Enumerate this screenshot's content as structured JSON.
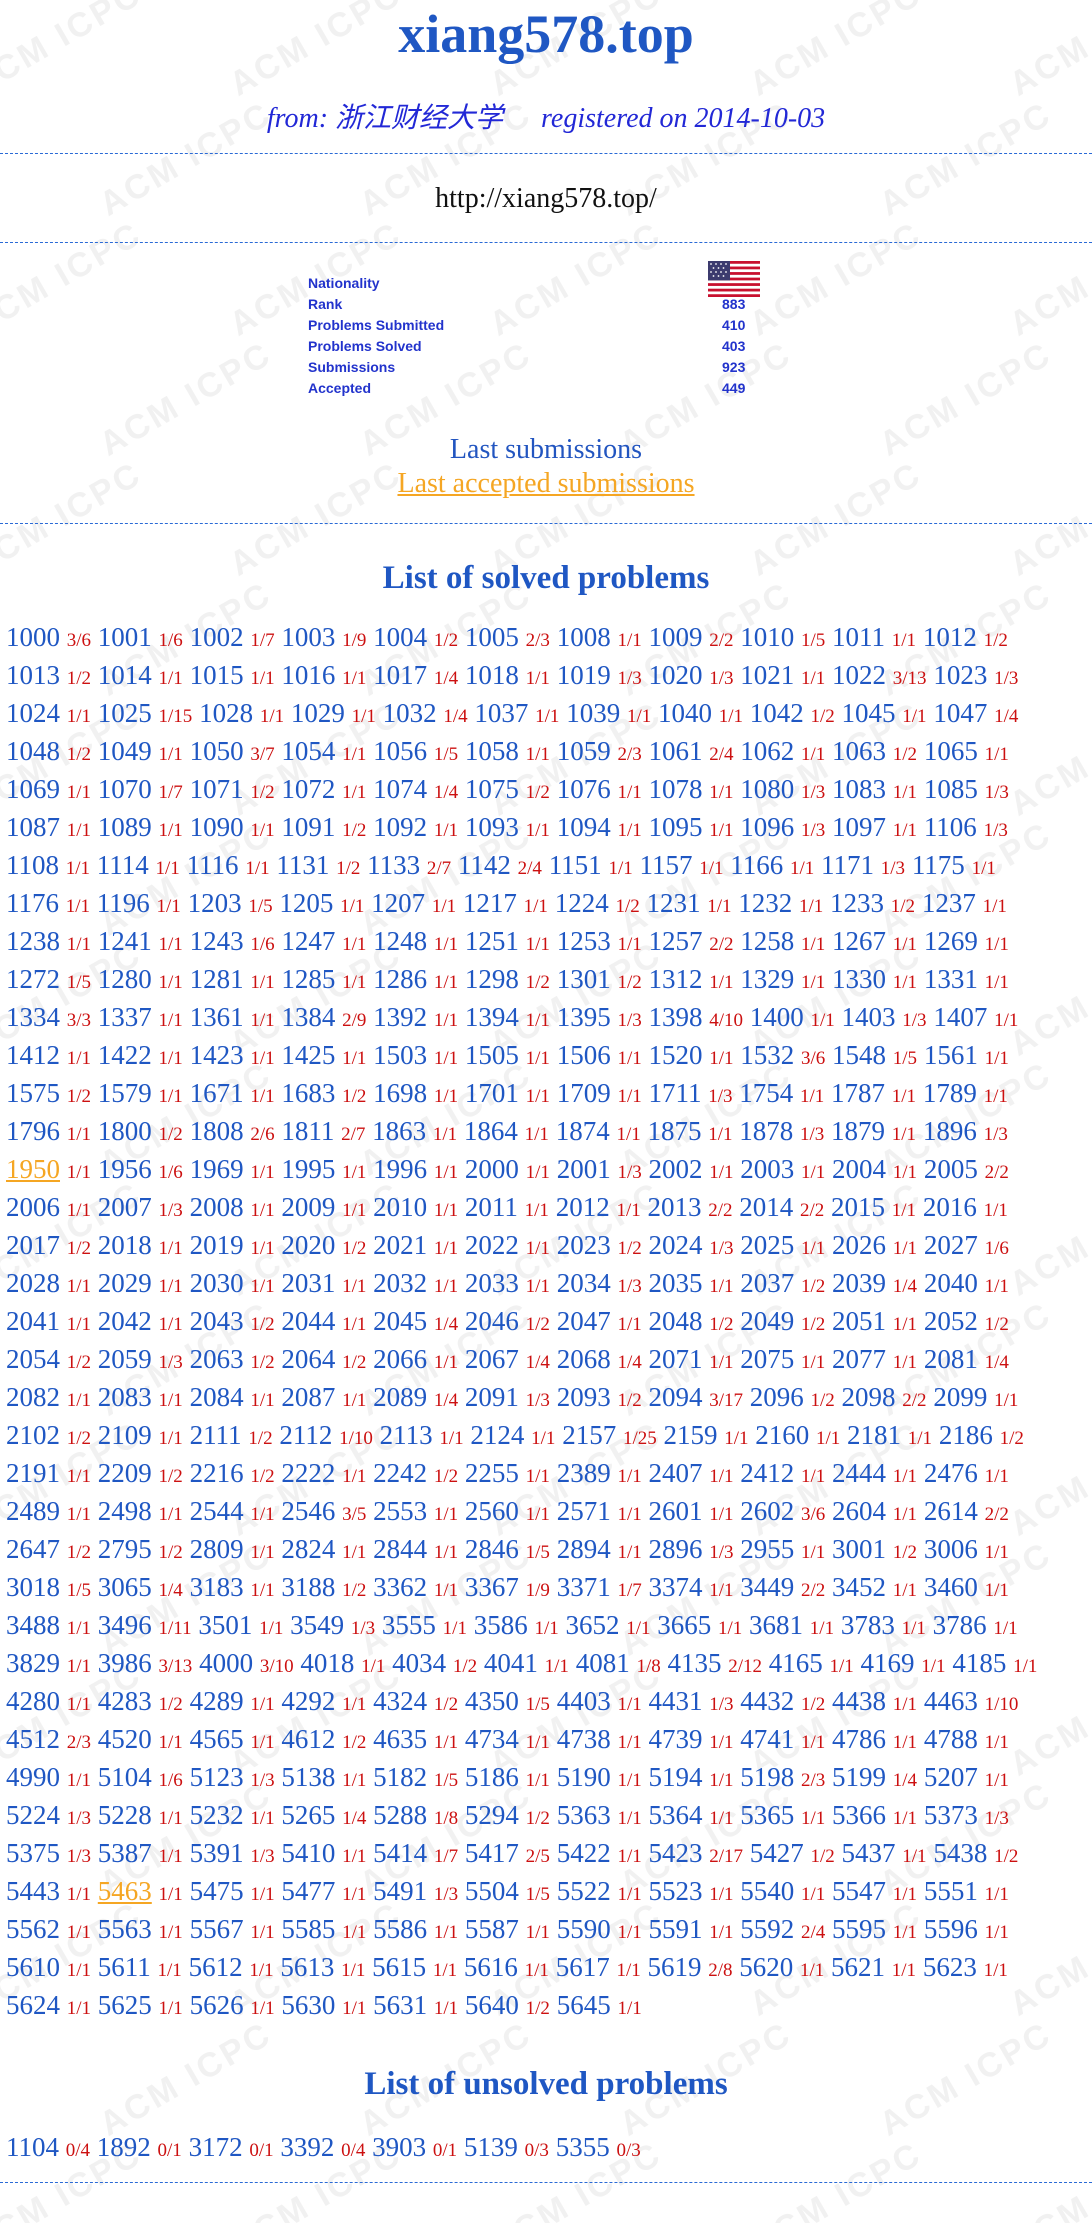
{
  "profile": {
    "title": "xiang578.top",
    "from_label": "from:",
    "school": "浙江财经大学",
    "registered_label": "registered on",
    "registered_date": "2014-10-03",
    "homepage": "http://xiang578.top/"
  },
  "stats": [
    {
      "label": "Nationality",
      "value": ""
    },
    {
      "label": "Rank",
      "value": "883"
    },
    {
      "label": "Problems Submitted",
      "value": "410"
    },
    {
      "label": "Problems Solved",
      "value": "403"
    },
    {
      "label": "Submissions",
      "value": "923"
    },
    {
      "label": "Accepted",
      "value": "449"
    }
  ],
  "links": {
    "last_submissions": "Last submissions",
    "last_accepted": "Last accepted submissions"
  },
  "solved_title": "List of solved problems",
  "unsolved_title": "List of unsolved problems",
  "watermark": "ACM ICPC",
  "colors": {
    "title": "#1f57c3",
    "ratio": "#cc1010",
    "highlight": "#f5a623",
    "divider": "#2a6ad6"
  },
  "solved": [
    [
      "1000",
      "3/6"
    ],
    [
      "1001",
      "1/6"
    ],
    [
      "1002",
      "1/7"
    ],
    [
      "1003",
      "1/9"
    ],
    [
      "1004",
      "1/2"
    ],
    [
      "1005",
      "2/3"
    ],
    [
      "1008",
      "1/1"
    ],
    [
      "1009",
      "2/2"
    ],
    [
      "1010",
      "1/5"
    ],
    [
      "1011",
      "1/1"
    ],
    [
      "1012",
      "1/2"
    ],
    [
      "1013",
      "1/2"
    ],
    [
      "1014",
      "1/1"
    ],
    [
      "1015",
      "1/1"
    ],
    [
      "1016",
      "1/1"
    ],
    [
      "1017",
      "1/4"
    ],
    [
      "1018",
      "1/1"
    ],
    [
      "1019",
      "1/3"
    ],
    [
      "1020",
      "1/3"
    ],
    [
      "1021",
      "1/1"
    ],
    [
      "1022",
      "3/13"
    ],
    [
      "1023",
      "1/3"
    ],
    [
      "1024",
      "1/1"
    ],
    [
      "1025",
      "1/15"
    ],
    [
      "1028",
      "1/1"
    ],
    [
      "1029",
      "1/1"
    ],
    [
      "1032",
      "1/4"
    ],
    [
      "1037",
      "1/1"
    ],
    [
      "1039",
      "1/1"
    ],
    [
      "1040",
      "1/1"
    ],
    [
      "1042",
      "1/2"
    ],
    [
      "1045",
      "1/1"
    ],
    [
      "1047",
      "1/4"
    ],
    [
      "1048",
      "1/2"
    ],
    [
      "1049",
      "1/1"
    ],
    [
      "1050",
      "3/7"
    ],
    [
      "1054",
      "1/1"
    ],
    [
      "1056",
      "1/5"
    ],
    [
      "1058",
      "1/1"
    ],
    [
      "1059",
      "2/3"
    ],
    [
      "1061",
      "2/4"
    ],
    [
      "1062",
      "1/1"
    ],
    [
      "1063",
      "1/2"
    ],
    [
      "1065",
      "1/1"
    ],
    [
      "1069",
      "1/1"
    ],
    [
      "1070",
      "1/7"
    ],
    [
      "1071",
      "1/2"
    ],
    [
      "1072",
      "1/1"
    ],
    [
      "1074",
      "1/4"
    ],
    [
      "1075",
      "1/2"
    ],
    [
      "1076",
      "1/1"
    ],
    [
      "1078",
      "1/1"
    ],
    [
      "1080",
      "1/3"
    ],
    [
      "1083",
      "1/1"
    ],
    [
      "1085",
      "1/3"
    ],
    [
      "1087",
      "1/1"
    ],
    [
      "1089",
      "1/1"
    ],
    [
      "1090",
      "1/1"
    ],
    [
      "1091",
      "1/2"
    ],
    [
      "1092",
      "1/1"
    ],
    [
      "1093",
      "1/1"
    ],
    [
      "1094",
      "1/1"
    ],
    [
      "1095",
      "1/1"
    ],
    [
      "1096",
      "1/3"
    ],
    [
      "1097",
      "1/1"
    ],
    [
      "1106",
      "1/3"
    ],
    [
      "1108",
      "1/1"
    ],
    [
      "1114",
      "1/1"
    ],
    [
      "1116",
      "1/1"
    ],
    [
      "1131",
      "1/2"
    ],
    [
      "1133",
      "2/7"
    ],
    [
      "1142",
      "2/4"
    ],
    [
      "1151",
      "1/1"
    ],
    [
      "1157",
      "1/1"
    ],
    [
      "1166",
      "1/1"
    ],
    [
      "1171",
      "1/3"
    ],
    [
      "1175",
      "1/1"
    ],
    [
      "1176",
      "1/1"
    ],
    [
      "1196",
      "1/1"
    ],
    [
      "1203",
      "1/5"
    ],
    [
      "1205",
      "1/1"
    ],
    [
      "1207",
      "1/1"
    ],
    [
      "1217",
      "1/1"
    ],
    [
      "1224",
      "1/2"
    ],
    [
      "1231",
      "1/1"
    ],
    [
      "1232",
      "1/1"
    ],
    [
      "1233",
      "1/2"
    ],
    [
      "1237",
      "1/1"
    ],
    [
      "1238",
      "1/1"
    ],
    [
      "1241",
      "1/1"
    ],
    [
      "1243",
      "1/6"
    ],
    [
      "1247",
      "1/1"
    ],
    [
      "1248",
      "1/1"
    ],
    [
      "1251",
      "1/1"
    ],
    [
      "1253",
      "1/1"
    ],
    [
      "1257",
      "2/2"
    ],
    [
      "1258",
      "1/1"
    ],
    [
      "1267",
      "1/1"
    ],
    [
      "1269",
      "1/1"
    ],
    [
      "1272",
      "1/5"
    ],
    [
      "1280",
      "1/1"
    ],
    [
      "1281",
      "1/1"
    ],
    [
      "1285",
      "1/1"
    ],
    [
      "1286",
      "1/1"
    ],
    [
      "1298",
      "1/2"
    ],
    [
      "1301",
      "1/2"
    ],
    [
      "1312",
      "1/1"
    ],
    [
      "1329",
      "1/1"
    ],
    [
      "1330",
      "1/1"
    ],
    [
      "1331",
      "1/1"
    ],
    [
      "1334",
      "3/3"
    ],
    [
      "1337",
      "1/1"
    ],
    [
      "1361",
      "1/1"
    ],
    [
      "1384",
      "2/9"
    ],
    [
      "1392",
      "1/1"
    ],
    [
      "1394",
      "1/1"
    ],
    [
      "1395",
      "1/3"
    ],
    [
      "1398",
      "4/10"
    ],
    [
      "1400",
      "1/1"
    ],
    [
      "1403",
      "1/3"
    ],
    [
      "1407",
      "1/1"
    ],
    [
      "1412",
      "1/1"
    ],
    [
      "1422",
      "1/1"
    ],
    [
      "1423",
      "1/1"
    ],
    [
      "1425",
      "1/1"
    ],
    [
      "1503",
      "1/1"
    ],
    [
      "1505",
      "1/1"
    ],
    [
      "1506",
      "1/1"
    ],
    [
      "1520",
      "1/1"
    ],
    [
      "1532",
      "3/6"
    ],
    [
      "1548",
      "1/5"
    ],
    [
      "1561",
      "1/1"
    ],
    [
      "1575",
      "1/2"
    ],
    [
      "1579",
      "1/1"
    ],
    [
      "1671",
      "1/1"
    ],
    [
      "1683",
      "1/2"
    ],
    [
      "1698",
      "1/1"
    ],
    [
      "1701",
      "1/1"
    ],
    [
      "1709",
      "1/1"
    ],
    [
      "1711",
      "1/3"
    ],
    [
      "1754",
      "1/1"
    ],
    [
      "1787",
      "1/1"
    ],
    [
      "1789",
      "1/1"
    ],
    [
      "1796",
      "1/1"
    ],
    [
      "1800",
      "1/2"
    ],
    [
      "1808",
      "2/6"
    ],
    [
      "1811",
      "2/7"
    ],
    [
      "1863",
      "1/1"
    ],
    [
      "1864",
      "1/1"
    ],
    [
      "1874",
      "1/1"
    ],
    [
      "1875",
      "1/1"
    ],
    [
      "1878",
      "1/3"
    ],
    [
      "1879",
      "1/1"
    ],
    [
      "1896",
      "1/3"
    ],
    [
      "1950",
      "1/1"
    ],
    [
      "1956",
      "1/6"
    ],
    [
      "1969",
      "1/1"
    ],
    [
      "1995",
      "1/1"
    ],
    [
      "1996",
      "1/1"
    ],
    [
      "2000",
      "1/1"
    ],
    [
      "2001",
      "1/3"
    ],
    [
      "2002",
      "1/1"
    ],
    [
      "2003",
      "1/1"
    ],
    [
      "2004",
      "1/1"
    ],
    [
      "2005",
      "2/2"
    ],
    [
      "2006",
      "1/1"
    ],
    [
      "2007",
      "1/3"
    ],
    [
      "2008",
      "1/1"
    ],
    [
      "2009",
      "1/1"
    ],
    [
      "2010",
      "1/1"
    ],
    [
      "2011",
      "1/1"
    ],
    [
      "2012",
      "1/1"
    ],
    [
      "2013",
      "2/2"
    ],
    [
      "2014",
      "2/2"
    ],
    [
      "2015",
      "1/1"
    ],
    [
      "2016",
      "1/1"
    ],
    [
      "2017",
      "1/2"
    ],
    [
      "2018",
      "1/1"
    ],
    [
      "2019",
      "1/1"
    ],
    [
      "2020",
      "1/2"
    ],
    [
      "2021",
      "1/1"
    ],
    [
      "2022",
      "1/1"
    ],
    [
      "2023",
      "1/2"
    ],
    [
      "2024",
      "1/3"
    ],
    [
      "2025",
      "1/1"
    ],
    [
      "2026",
      "1/1"
    ],
    [
      "2027",
      "1/6"
    ],
    [
      "2028",
      "1/1"
    ],
    [
      "2029",
      "1/1"
    ],
    [
      "2030",
      "1/1"
    ],
    [
      "2031",
      "1/1"
    ],
    [
      "2032",
      "1/1"
    ],
    [
      "2033",
      "1/1"
    ],
    [
      "2034",
      "1/3"
    ],
    [
      "2035",
      "1/1"
    ],
    [
      "2037",
      "1/2"
    ],
    [
      "2039",
      "1/4"
    ],
    [
      "2040",
      "1/1"
    ],
    [
      "2041",
      "1/1"
    ],
    [
      "2042",
      "1/1"
    ],
    [
      "2043",
      "1/2"
    ],
    [
      "2044",
      "1/1"
    ],
    [
      "2045",
      "1/4"
    ],
    [
      "2046",
      "1/2"
    ],
    [
      "2047",
      "1/1"
    ],
    [
      "2048",
      "1/2"
    ],
    [
      "2049",
      "1/2"
    ],
    [
      "2051",
      "1/1"
    ],
    [
      "2052",
      "1/2"
    ],
    [
      "2054",
      "1/2"
    ],
    [
      "2059",
      "1/3"
    ],
    [
      "2063",
      "1/2"
    ],
    [
      "2064",
      "1/2"
    ],
    [
      "2066",
      "1/1"
    ],
    [
      "2067",
      "1/4"
    ],
    [
      "2068",
      "1/4"
    ],
    [
      "2071",
      "1/1"
    ],
    [
      "2075",
      "1/1"
    ],
    [
      "2077",
      "1/1"
    ],
    [
      "2081",
      "1/4"
    ],
    [
      "2082",
      "1/1"
    ],
    [
      "2083",
      "1/1"
    ],
    [
      "2084",
      "1/1"
    ],
    [
      "2087",
      "1/1"
    ],
    [
      "2089",
      "1/4"
    ],
    [
      "2091",
      "1/3"
    ],
    [
      "2093",
      "1/2"
    ],
    [
      "2094",
      "3/17"
    ],
    [
      "2096",
      "1/2"
    ],
    [
      "2098",
      "2/2"
    ],
    [
      "2099",
      "1/1"
    ],
    [
      "2102",
      "1/2"
    ],
    [
      "2109",
      "1/1"
    ],
    [
      "2111",
      "1/2"
    ],
    [
      "2112",
      "1/10"
    ],
    [
      "2113",
      "1/1"
    ],
    [
      "2124",
      "1/1"
    ],
    [
      "2157",
      "1/25"
    ],
    [
      "2159",
      "1/1"
    ],
    [
      "2160",
      "1/1"
    ],
    [
      "2181",
      "1/1"
    ],
    [
      "2186",
      "1/2"
    ],
    [
      "2191",
      "1/1"
    ],
    [
      "2209",
      "1/2"
    ],
    [
      "2216",
      "1/2"
    ],
    [
      "2222",
      "1/1"
    ],
    [
      "2242",
      "1/2"
    ],
    [
      "2255",
      "1/1"
    ],
    [
      "2389",
      "1/1"
    ],
    [
      "2407",
      "1/1"
    ],
    [
      "2412",
      "1/1"
    ],
    [
      "2444",
      "1/1"
    ],
    [
      "2476",
      "1/1"
    ],
    [
      "2489",
      "1/1"
    ],
    [
      "2498",
      "1/1"
    ],
    [
      "2544",
      "1/1"
    ],
    [
      "2546",
      "3/5"
    ],
    [
      "2553",
      "1/1"
    ],
    [
      "2560",
      "1/1"
    ],
    [
      "2571",
      "1/1"
    ],
    [
      "2601",
      "1/1"
    ],
    [
      "2602",
      "3/6"
    ],
    [
      "2604",
      "1/1"
    ],
    [
      "2614",
      "2/2"
    ],
    [
      "2647",
      "1/2"
    ],
    [
      "2795",
      "1/2"
    ],
    [
      "2809",
      "1/1"
    ],
    [
      "2824",
      "1/1"
    ],
    [
      "2844",
      "1/1"
    ],
    [
      "2846",
      "1/5"
    ],
    [
      "2894",
      "1/1"
    ],
    [
      "2896",
      "1/3"
    ],
    [
      "2955",
      "1/1"
    ],
    [
      "3001",
      "1/2"
    ],
    [
      "3006",
      "1/1"
    ],
    [
      "3018",
      "1/5"
    ],
    [
      "3065",
      "1/4"
    ],
    [
      "3183",
      "1/1"
    ],
    [
      "3188",
      "1/2"
    ],
    [
      "3362",
      "1/1"
    ],
    [
      "3367",
      "1/9"
    ],
    [
      "3371",
      "1/7"
    ],
    [
      "3374",
      "1/1"
    ],
    [
      "3449",
      "2/2"
    ],
    [
      "3452",
      "1/1"
    ],
    [
      "3460",
      "1/1"
    ],
    [
      "3488",
      "1/1"
    ],
    [
      "3496",
      "1/11"
    ],
    [
      "3501",
      "1/1"
    ],
    [
      "3549",
      "1/3"
    ],
    [
      "3555",
      "1/1"
    ],
    [
      "3586",
      "1/1"
    ],
    [
      "3652",
      "1/1"
    ],
    [
      "3665",
      "1/1"
    ],
    [
      "3681",
      "1/1"
    ],
    [
      "3783",
      "1/1"
    ],
    [
      "3786",
      "1/1"
    ],
    [
      "3829",
      "1/1"
    ],
    [
      "3986",
      "3/13"
    ],
    [
      "4000",
      "3/10"
    ],
    [
      "4018",
      "1/1"
    ],
    [
      "4034",
      "1/2"
    ],
    [
      "4041",
      "1/1"
    ],
    [
      "4081",
      "1/8"
    ],
    [
      "4135",
      "2/12"
    ],
    [
      "4165",
      "1/1"
    ],
    [
      "4169",
      "1/1"
    ],
    [
      "4185",
      "1/1"
    ],
    [
      "4280",
      "1/1"
    ],
    [
      "4283",
      "1/2"
    ],
    [
      "4289",
      "1/1"
    ],
    [
      "4292",
      "1/1"
    ],
    [
      "4324",
      "1/2"
    ],
    [
      "4350",
      "1/5"
    ],
    [
      "4403",
      "1/1"
    ],
    [
      "4431",
      "1/3"
    ],
    [
      "4432",
      "1/2"
    ],
    [
      "4438",
      "1/1"
    ],
    [
      "4463",
      "1/10"
    ],
    [
      "4512",
      "2/3"
    ],
    [
      "4520",
      "1/1"
    ],
    [
      "4565",
      "1/1"
    ],
    [
      "4612",
      "1/2"
    ],
    [
      "4635",
      "1/1"
    ],
    [
      "4734",
      "1/1"
    ],
    [
      "4738",
      "1/1"
    ],
    [
      "4739",
      "1/1"
    ],
    [
      "4741",
      "1/1"
    ],
    [
      "4786",
      "1/1"
    ],
    [
      "4788",
      "1/1"
    ],
    [
      "4990",
      "1/1"
    ],
    [
      "5104",
      "1/6"
    ],
    [
      "5123",
      "1/3"
    ],
    [
      "5138",
      "1/1"
    ],
    [
      "5182",
      "1/5"
    ],
    [
      "5186",
      "1/1"
    ],
    [
      "5190",
      "1/1"
    ],
    [
      "5194",
      "1/1"
    ],
    [
      "5198",
      "2/3"
    ],
    [
      "5199",
      "1/4"
    ],
    [
      "5207",
      "1/1"
    ],
    [
      "5224",
      "1/3"
    ],
    [
      "5228",
      "1/1"
    ],
    [
      "5232",
      "1/1"
    ],
    [
      "5265",
      "1/4"
    ],
    [
      "5288",
      "1/8"
    ],
    [
      "5294",
      "1/2"
    ],
    [
      "5363",
      "1/1"
    ],
    [
      "5364",
      "1/1"
    ],
    [
      "5365",
      "1/1"
    ],
    [
      "5366",
      "1/1"
    ],
    [
      "5373",
      "1/3"
    ],
    [
      "5375",
      "1/3"
    ],
    [
      "5387",
      "1/1"
    ],
    [
      "5391",
      "1/3"
    ],
    [
      "5410",
      "1/1"
    ],
    [
      "5414",
      "1/7"
    ],
    [
      "5417",
      "2/5"
    ],
    [
      "5422",
      "1/1"
    ],
    [
      "5423",
      "2/17"
    ],
    [
      "5427",
      "1/2"
    ],
    [
      "5437",
      "1/1"
    ],
    [
      "5438",
      "1/2"
    ],
    [
      "5443",
      "1/1"
    ],
    [
      "5463",
      "1/1"
    ],
    [
      "5475",
      "1/1"
    ],
    [
      "5477",
      "1/1"
    ],
    [
      "5491",
      "1/3"
    ],
    [
      "5504",
      "1/5"
    ],
    [
      "5522",
      "1/1"
    ],
    [
      "5523",
      "1/1"
    ],
    [
      "5540",
      "1/1"
    ],
    [
      "5547",
      "1/1"
    ],
    [
      "5551",
      "1/1"
    ],
    [
      "5562",
      "1/1"
    ],
    [
      "5563",
      "1/1"
    ],
    [
      "5567",
      "1/1"
    ],
    [
      "5585",
      "1/1"
    ],
    [
      "5586",
      "1/1"
    ],
    [
      "5587",
      "1/1"
    ],
    [
      "5590",
      "1/1"
    ],
    [
      "5591",
      "1/1"
    ],
    [
      "5592",
      "2/4"
    ],
    [
      "5595",
      "1/1"
    ],
    [
      "5596",
      "1/1"
    ],
    [
      "5610",
      "1/1"
    ],
    [
      "5611",
      "1/1"
    ],
    [
      "5612",
      "1/1"
    ],
    [
      "5613",
      "1/1"
    ],
    [
      "5615",
      "1/1"
    ],
    [
      "5616",
      "1/1"
    ],
    [
      "5617",
      "1/1"
    ],
    [
      "5619",
      "2/8"
    ],
    [
      "5620",
      "1/1"
    ],
    [
      "5621",
      "1/1"
    ],
    [
      "5623",
      "1/1"
    ],
    [
      "5624",
      "1/1"
    ],
    [
      "5625",
      "1/1"
    ],
    [
      "5626",
      "1/1"
    ],
    [
      "5630",
      "1/1"
    ],
    [
      "5631",
      "1/1"
    ],
    [
      "5640",
      "1/2"
    ],
    [
      "5645",
      "1/1"
    ]
  ],
  "highlighted": [
    "1950",
    "5463"
  ],
  "unsolved": [
    [
      "1104",
      "0/4"
    ],
    [
      "1892",
      "0/1"
    ],
    [
      "3172",
      "0/1"
    ],
    [
      "3392",
      "0/4"
    ],
    [
      "3903",
      "0/1"
    ],
    [
      "5139",
      "0/3"
    ],
    [
      "5355",
      "0/3"
    ]
  ]
}
